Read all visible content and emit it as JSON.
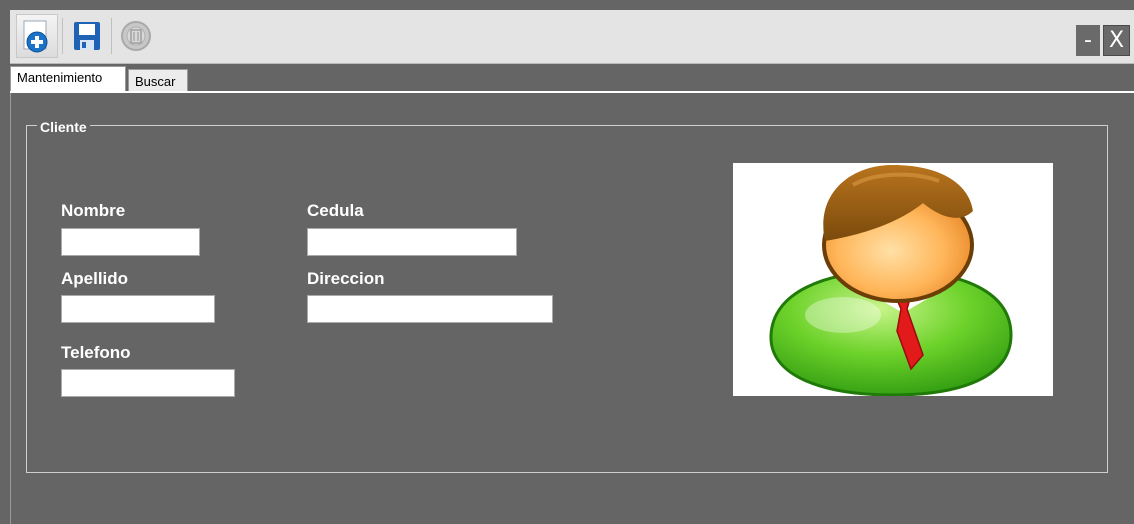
{
  "toolbar": {
    "buttons": [
      {
        "icon": "add-new-icon",
        "color": "#1a73c8"
      },
      {
        "icon": "save-disk-icon",
        "color": "#1e63b4"
      },
      {
        "icon": "delete-disabled-icon",
        "color": "#b8b8b8"
      }
    ]
  },
  "window_controls": {
    "minimize": "-",
    "close": "X"
  },
  "tabs": [
    {
      "label": "Mantenimiento",
      "active": true
    },
    {
      "label": "Buscar",
      "active": false
    }
  ],
  "group": {
    "title": "Cliente"
  },
  "form": {
    "nombre": {
      "label": "Nombre",
      "value": ""
    },
    "cedula": {
      "label": "Cedula",
      "value": ""
    },
    "apellido": {
      "label": "Apellido",
      "value": ""
    },
    "direccion": {
      "label": "Direccion",
      "value": ""
    },
    "telefono": {
      "label": "Telefono",
      "value": ""
    }
  },
  "photo": {
    "icon": "user-avatar-icon"
  },
  "colors": {
    "background": "#656565",
    "toolbar": "#e4e4e4",
    "label_text": "#ffffff"
  }
}
